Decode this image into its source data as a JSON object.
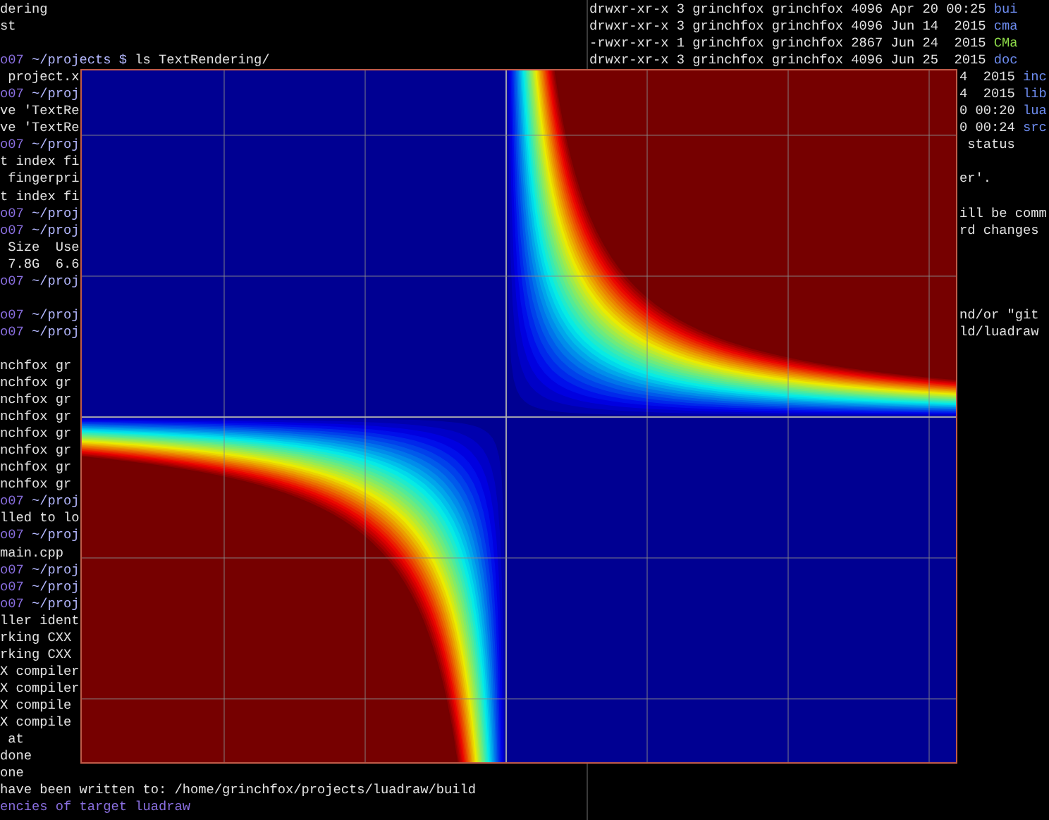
{
  "left_terminal": {
    "lines": [
      {
        "kind": "full",
        "segments": [
          {
            "kind": "plain",
            "text": "dering"
          }
        ]
      },
      {
        "kind": "full",
        "segments": [
          {
            "kind": "plain",
            "text": "st"
          }
        ]
      },
      {
        "kind": "blank"
      },
      {
        "kind": "full",
        "segments": [
          {
            "kind": "host",
            "text": "o07"
          },
          {
            "kind": "path",
            "text": " ~/projects $ "
          },
          {
            "kind": "plain",
            "text": "ls TextRendering/"
          }
        ]
      },
      {
        "kind": "full",
        "segments": [
          {
            "kind": "plain",
            "text": " project.x"
          }
        ]
      },
      {
        "kind": "full",
        "segments": [
          {
            "kind": "host",
            "text": "o07"
          },
          {
            "kind": "path",
            "text": " ~/proj"
          }
        ]
      },
      {
        "kind": "full",
        "segments": [
          {
            "kind": "plain",
            "text": "ve 'TextRe"
          }
        ]
      },
      {
        "kind": "full",
        "segments": [
          {
            "kind": "plain",
            "text": "ve 'TextRe"
          }
        ]
      },
      {
        "kind": "full",
        "segments": [
          {
            "kind": "host",
            "text": "o07"
          },
          {
            "kind": "path",
            "text": " ~/proj"
          }
        ]
      },
      {
        "kind": "full",
        "segments": [
          {
            "kind": "plain",
            "text": "t index fi"
          }
        ]
      },
      {
        "kind": "full",
        "segments": [
          {
            "kind": "plain",
            "text": " fingerpri"
          }
        ]
      },
      {
        "kind": "full",
        "segments": [
          {
            "kind": "plain",
            "text": "t index fi"
          }
        ]
      },
      {
        "kind": "full",
        "segments": [
          {
            "kind": "host",
            "text": "o07"
          },
          {
            "kind": "path",
            "text": " ~/proj"
          }
        ]
      },
      {
        "kind": "full",
        "segments": [
          {
            "kind": "host",
            "text": "o07"
          },
          {
            "kind": "path",
            "text": " ~/proj"
          }
        ]
      },
      {
        "kind": "full",
        "segments": [
          {
            "kind": "plain",
            "text": " Size  Use"
          }
        ]
      },
      {
        "kind": "full",
        "segments": [
          {
            "kind": "plain",
            "text": " 7.8G  6.6"
          }
        ]
      },
      {
        "kind": "full",
        "segments": [
          {
            "kind": "host",
            "text": "o07"
          },
          {
            "kind": "path",
            "text": " ~/proj"
          }
        ]
      },
      {
        "kind": "blank"
      },
      {
        "kind": "full",
        "segments": [
          {
            "kind": "host",
            "text": "o07"
          },
          {
            "kind": "path",
            "text": " ~/proj"
          }
        ]
      },
      {
        "kind": "full",
        "segments": [
          {
            "kind": "host",
            "text": "o07"
          },
          {
            "kind": "path",
            "text": " ~/proj"
          }
        ]
      },
      {
        "kind": "blank"
      },
      {
        "kind": "full",
        "segments": [
          {
            "kind": "plain",
            "text": "nchfox gr"
          }
        ]
      },
      {
        "kind": "full",
        "segments": [
          {
            "kind": "plain",
            "text": "nchfox gr"
          }
        ]
      },
      {
        "kind": "full",
        "segments": [
          {
            "kind": "plain",
            "text": "nchfox gr"
          }
        ]
      },
      {
        "kind": "full",
        "segments": [
          {
            "kind": "plain",
            "text": "nchfox gr"
          }
        ]
      },
      {
        "kind": "full",
        "segments": [
          {
            "kind": "plain",
            "text": "nchfox gr"
          }
        ]
      },
      {
        "kind": "full",
        "segments": [
          {
            "kind": "plain",
            "text": "nchfox gr"
          }
        ]
      },
      {
        "kind": "full",
        "segments": [
          {
            "kind": "plain",
            "text": "nchfox gr"
          }
        ]
      },
      {
        "kind": "full",
        "segments": [
          {
            "kind": "plain",
            "text": "nchfox gr"
          }
        ]
      },
      {
        "kind": "full",
        "segments": [
          {
            "kind": "host",
            "text": "o07"
          },
          {
            "kind": "path",
            "text": " ~/proj"
          }
        ]
      },
      {
        "kind": "full",
        "segments": [
          {
            "kind": "plain",
            "text": "lled to lo"
          }
        ]
      },
      {
        "kind": "full",
        "segments": [
          {
            "kind": "host",
            "text": "o07"
          },
          {
            "kind": "path",
            "text": " ~/proj"
          }
        ]
      },
      {
        "kind": "full",
        "segments": [
          {
            "kind": "plain",
            "text": "main.cpp"
          }
        ]
      },
      {
        "kind": "full",
        "segments": [
          {
            "kind": "host",
            "text": "o07"
          },
          {
            "kind": "path",
            "text": " ~/proj"
          }
        ]
      },
      {
        "kind": "full",
        "segments": [
          {
            "kind": "host",
            "text": "o07"
          },
          {
            "kind": "path",
            "text": " ~/proj"
          }
        ]
      },
      {
        "kind": "full",
        "segments": [
          {
            "kind": "host",
            "text": "o07"
          },
          {
            "kind": "path",
            "text": " ~/proj"
          }
        ]
      },
      {
        "kind": "full",
        "segments": [
          {
            "kind": "plain",
            "text": "ller ident"
          }
        ]
      },
      {
        "kind": "full",
        "segments": [
          {
            "kind": "plain",
            "text": "rking CXX"
          }
        ]
      },
      {
        "kind": "full",
        "segments": [
          {
            "kind": "plain",
            "text": "rking CXX"
          }
        ]
      },
      {
        "kind": "full",
        "segments": [
          {
            "kind": "plain",
            "text": "X compiler"
          }
        ]
      },
      {
        "kind": "full",
        "segments": [
          {
            "kind": "plain",
            "text": "X compiler"
          }
        ]
      },
      {
        "kind": "full",
        "segments": [
          {
            "kind": "plain",
            "text": "X compile"
          }
        ]
      },
      {
        "kind": "full",
        "segments": [
          {
            "kind": "plain",
            "text": "X compile"
          }
        ]
      },
      {
        "kind": "full",
        "segments": [
          {
            "kind": "plain",
            "text": " at"
          }
        ]
      },
      {
        "kind": "full",
        "segments": [
          {
            "kind": "plain",
            "text": "done"
          }
        ]
      },
      {
        "kind": "full",
        "segments": [
          {
            "kind": "plain",
            "text": "one"
          }
        ]
      },
      {
        "kind": "full",
        "segments": [
          {
            "kind": "plain",
            "text": "have been written to: /home/grinchfox/projects/luadraw/build"
          }
        ]
      },
      {
        "kind": "full",
        "segments": [
          {
            "kind": "host",
            "text": "encies of target luadraw"
          }
        ]
      }
    ]
  },
  "right_terminal": {
    "lines": [
      {
        "kind": "full",
        "segments": [
          {
            "kind": "plain",
            "text": "drwxr-xr-x 3 grinchfox grinchfox 4096 Apr 20 00:25 "
          },
          {
            "kind": "directory",
            "text": "bui"
          }
        ]
      },
      {
        "kind": "full",
        "segments": [
          {
            "kind": "plain",
            "text": "drwxr-xr-x 3 grinchfox grinchfox 4096 Jun 14  2015 "
          },
          {
            "kind": "directory",
            "text": "cma"
          }
        ]
      },
      {
        "kind": "full",
        "segments": [
          {
            "kind": "plain",
            "text": "-rwxr-xr-x 1 grinchfox grinchfox 2867 Jun 24  2015 "
          },
          {
            "kind": "executable",
            "text": "CMa"
          }
        ]
      },
      {
        "kind": "full",
        "segments": [
          {
            "kind": "plain",
            "text": "drwxr-xr-x 3 grinchfox grinchfox 4096 Jun 25  2015 "
          },
          {
            "kind": "directory",
            "text": "doc"
          }
        ]
      },
      {
        "kind": "covered",
        "segments": [
          {
            "kind": "plain",
            "text": "4  2015 "
          },
          {
            "kind": "directory",
            "text": "inc"
          }
        ]
      },
      {
        "kind": "covered",
        "segments": [
          {
            "kind": "plain",
            "text": "4  2015 "
          },
          {
            "kind": "directory",
            "text": "lib"
          }
        ]
      },
      {
        "kind": "covered",
        "segments": [
          {
            "kind": "plain",
            "text": "0 00:20 "
          },
          {
            "kind": "directory",
            "text": "lua"
          }
        ]
      },
      {
        "kind": "covered",
        "segments": [
          {
            "kind": "plain",
            "text": "0 00:24 "
          },
          {
            "kind": "directory",
            "text": "src"
          }
        ]
      },
      {
        "kind": "covered",
        "segments": [
          {
            "kind": "plain",
            "text": " status"
          }
        ]
      },
      {
        "kind": "blank"
      },
      {
        "kind": "covered",
        "segments": [
          {
            "kind": "plain",
            "text": "er'."
          }
        ]
      },
      {
        "kind": "blank"
      },
      {
        "kind": "covered",
        "segments": [
          {
            "kind": "plain",
            "text": "ill be comm"
          }
        ]
      },
      {
        "kind": "covered",
        "segments": [
          {
            "kind": "plain",
            "text": "rd changes"
          }
        ]
      },
      {
        "kind": "blank"
      },
      {
        "kind": "blank"
      },
      {
        "kind": "blank"
      },
      {
        "kind": "blank"
      },
      {
        "kind": "covered",
        "segments": [
          {
            "kind": "plain",
            "text": "nd/or \"git"
          }
        ]
      },
      {
        "kind": "covered",
        "segments": [
          {
            "kind": "plain",
            "text": "ld/luadraw"
          }
        ]
      }
    ]
  },
  "plot_window": {
    "kind": "heatmap"
  }
}
